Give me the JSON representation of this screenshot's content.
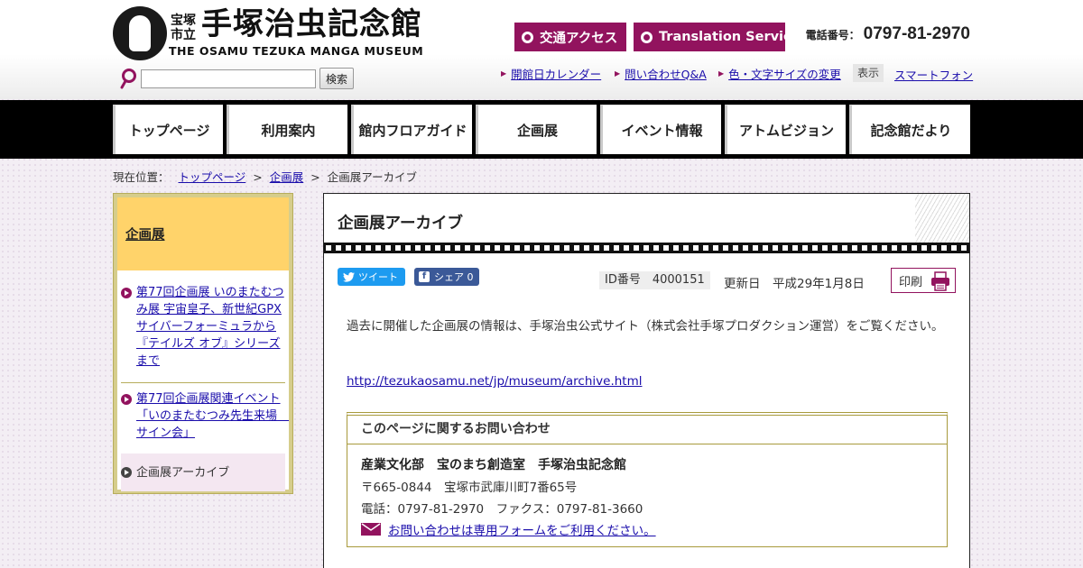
{
  "header": {
    "logo": {
      "city": "宝塚市立",
      "name": "手塚治虫記念館",
      "english": "THE OSAMU TEZUKA MANGA MUSEUM"
    },
    "search": {
      "placeholder": "",
      "button_label": "検索"
    },
    "pills": {
      "access": "交通アクセス",
      "translation": "Translation Service"
    },
    "phone": {
      "label": "電話番号：",
      "number": "0797-81-2970"
    },
    "util_links": {
      "calendar": "開館日カレンダー",
      "qa": "問い合わせQ&A",
      "fontsize": "色・文字サイズの変更",
      "display_label": "表示",
      "smartphone": "スマートフォン"
    }
  },
  "nav": {
    "items": [
      "トップページ",
      "利用案内",
      "館内フロアガイド",
      "企画展",
      "イベント情報",
      "アトムビジョン",
      "記念館だより"
    ]
  },
  "breadcrumb": {
    "label": "現在位置：",
    "links": [
      "トップページ",
      "企画展"
    ],
    "current": "企画展アーカイブ"
  },
  "sidebar": {
    "heading": "企画展",
    "items": [
      "第77回企画展 いのまたむつみ展 宇宙皇子、新世紀GPXサイバーフォーミュラから『テイルズ オブ』シリーズまで",
      "第77回企画展関連イベント「いのまたむつみ先生来場　サイン会」",
      "企画展アーカイブ"
    ]
  },
  "main": {
    "title": "企画展アーカイブ",
    "social": {
      "tweet": "ツイート",
      "share": "シェア 0"
    },
    "id_label": "ID番号　4000151",
    "updated": "更新日　平成29年1月8日",
    "print_label": "印刷",
    "body": "過去に開催した企画展の情報は、手塚治虫公式サイト（株式会社手塚プロダクション運営）をご覧ください。",
    "link": "http://tezukaosamu.net/jp/museum/archive.html",
    "contact": {
      "heading": "このページに関するお問い合わせ",
      "dept": "産業文化部　宝のまち創造室　手塚治虫記念館",
      "address": "〒665-0844　宝塚市武庫川町7番65号",
      "tel": "電話：0797-81-2970　ファクス：0797-81-3660",
      "form": "お問い合わせは専用フォームをご利用ください。"
    }
  },
  "colors": {
    "accent": "#92135e",
    "nav_bg": "#000000",
    "sidebar_head": "#ffd36a",
    "sidebar_border": "#d6cd8c"
  },
  "icons": [
    "search-icon",
    "ring-icon",
    "triangle-bullet-icon",
    "bullet-arrow-icon",
    "twitter-icon",
    "facebook-icon",
    "printer-icon",
    "mail-icon"
  ]
}
